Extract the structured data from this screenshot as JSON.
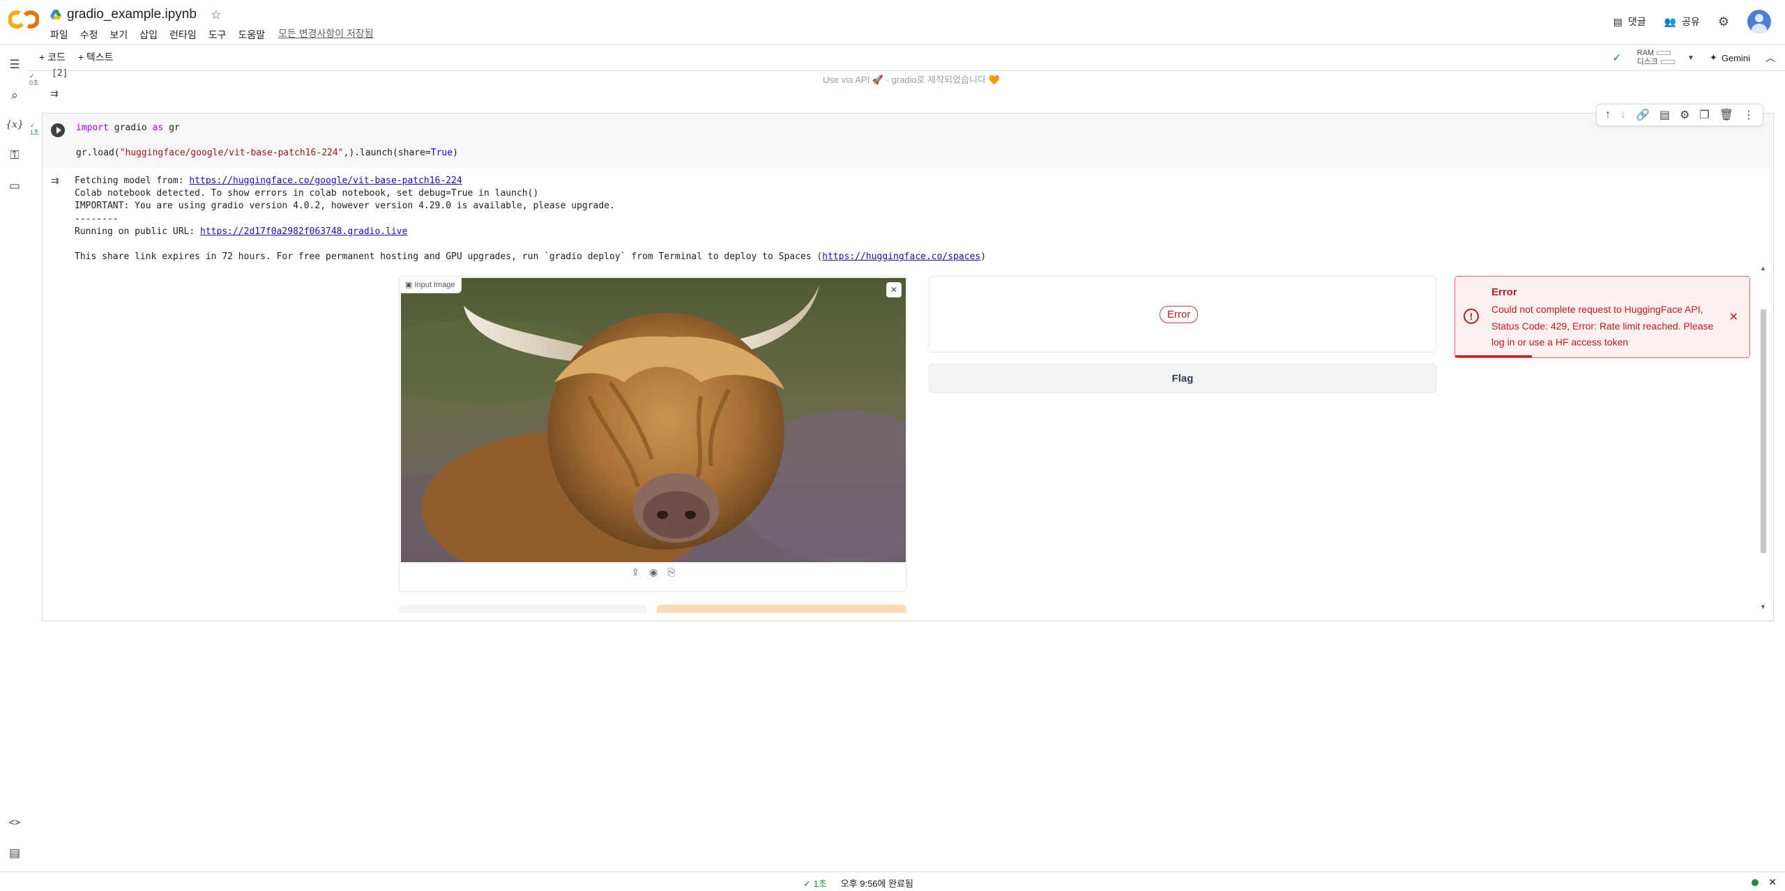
{
  "app": {
    "doc_title": "gradio_example.ipynb",
    "menu": [
      "파일",
      "수정",
      "보기",
      "삽입",
      "런타임",
      "도구",
      "도움말"
    ],
    "saved_status": "모든 변경사항이 저장됨"
  },
  "top_right": {
    "comments_label": "댓글",
    "share_label": "공유"
  },
  "toolbar": {
    "add_code": "+ 코드",
    "add_text": "+ 텍스트",
    "ram_label": "RAM",
    "disk_label": "디스크",
    "gemini_label": "Gemini"
  },
  "prev_cell": {
    "exec_time": "0초",
    "count": "[2]",
    "gradio_footer": "Use via API  🚀  ·  gradio로 제작되었습니다 🧡"
  },
  "cell": {
    "exec_time": "1초",
    "code_line1_kw1": "import",
    "code_line1_mod": " gradio ",
    "code_line1_kw2": "as",
    "code_line1_alias": " gr",
    "code_line2_pre": "gr.load(",
    "code_line2_str": "\"huggingface/google/vit-base-patch16-224\"",
    "code_line2_mid": ",).launch(share=",
    "code_line2_bool": "True",
    "code_line2_post": ")",
    "out_fetch_pre": "Fetching model from: ",
    "out_fetch_link": "https://huggingface.co/google/vit-base-patch16-224",
    "out_colab": "Colab notebook detected. To show errors in colab notebook, set debug=True in launch()",
    "out_important": "IMPORTANT: You are using gradio version 4.0.2, however version 4.29.0 is available, please upgrade.",
    "out_sep": "--------",
    "out_running_pre": "Running on public URL: ",
    "out_running_link": "https://2d17f0a2982f063748.gradio.live",
    "out_share_pre": "This share link expires in 72 hours. For free permanent hosting and GPU upgrades, run `gradio deploy` from Terminal to deploy to Spaces (",
    "out_share_link": "https://huggingface.co/spaces",
    "out_share_post": ")"
  },
  "gradio": {
    "input_label": "Input Image",
    "error_pill": "Error",
    "flag_label": "Flag",
    "toast_title": "Error",
    "toast_message": "Could not complete request to HuggingFace API, Status Code: 429, Error: Rate limit reached. Please log in or use a HF access token"
  },
  "statusbar": {
    "check_time": "✓ 1초",
    "completed": "오후 9:56에 완료됨"
  },
  "colors": {
    "error_red": "#b91c1c",
    "colab_orange": "#f9ab00",
    "link_blue": "#1a0dab"
  }
}
